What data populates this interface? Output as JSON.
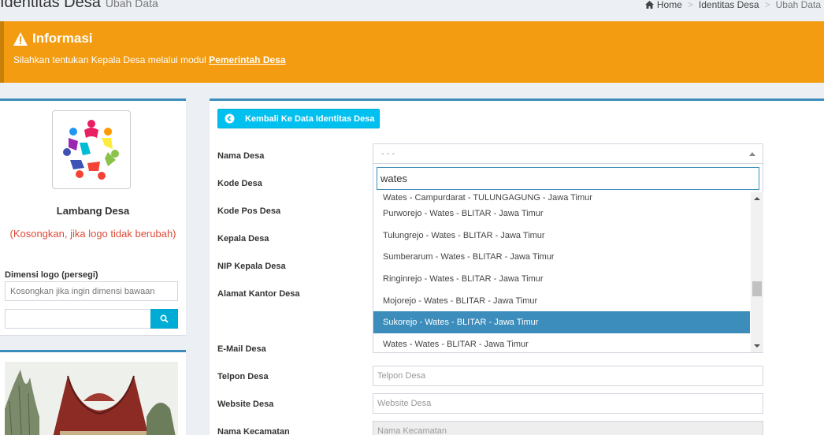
{
  "header": {
    "title": "Identitas Desa",
    "subtitle": "Ubah Data",
    "breadcrumb": [
      "Home",
      "Identitas Desa",
      "Ubah Data"
    ]
  },
  "callout": {
    "title": "Informasi",
    "text": "Silahkan tentukan Kepala Desa melalui modul ",
    "link": "Pemerintah Desa",
    "color": "#f39c12"
  },
  "logo_panel": {
    "title": "Lambang Desa",
    "note": "(Kosongkan, jika logo tidak berubah)",
    "dim_label": "Dimensi logo (persegi)",
    "dim_placeholder": "Kosongkan jika ingin dimensi bawaan"
  },
  "form": {
    "back_button": "Kembali Ke Data Identitas Desa",
    "labels": {
      "nama_desa": "Nama Desa",
      "kode_desa": "Kode Desa",
      "kode_pos": "Kode Pos Desa",
      "kepala_desa": "Kepala Desa",
      "nip": "NIP Kepala Desa",
      "alamat": "Alamat Kantor Desa",
      "email": "E-Mail Desa",
      "telpon": "Telpon Desa",
      "website": "Website Desa",
      "kecamatan": "Nama Kecamatan"
    },
    "select_value": "- - -",
    "search_value": "wates",
    "options": [
      "Wates - Campurdarat - TULUNGAGUNG - Jawa Timur",
      "Purworejo - Wates - BLITAR - Jawa Timur",
      "Tulungrejo - Wates - BLITAR - Jawa Timur",
      "Sumberarum - Wates - BLITAR - Jawa Timur",
      "Ringinrejo - Wates - BLITAR - Jawa Timur",
      "Mojorejo - Wates - BLITAR - Jawa Timur",
      "Sukorejo - Wates - BLITAR - Jawa Timur",
      "Wates - Wates - BLITAR - Jawa Timur"
    ],
    "selected_option": "Sukorejo - Wates - BLITAR - Jawa Timur",
    "placeholders": {
      "telpon": "Telpon Desa",
      "website": "Website Desa",
      "kecamatan": "Nama Kecamatan"
    }
  },
  "colors": {
    "primary": "#3c8dbc",
    "info": "#00c0ef",
    "danger": "#dd4b39"
  }
}
